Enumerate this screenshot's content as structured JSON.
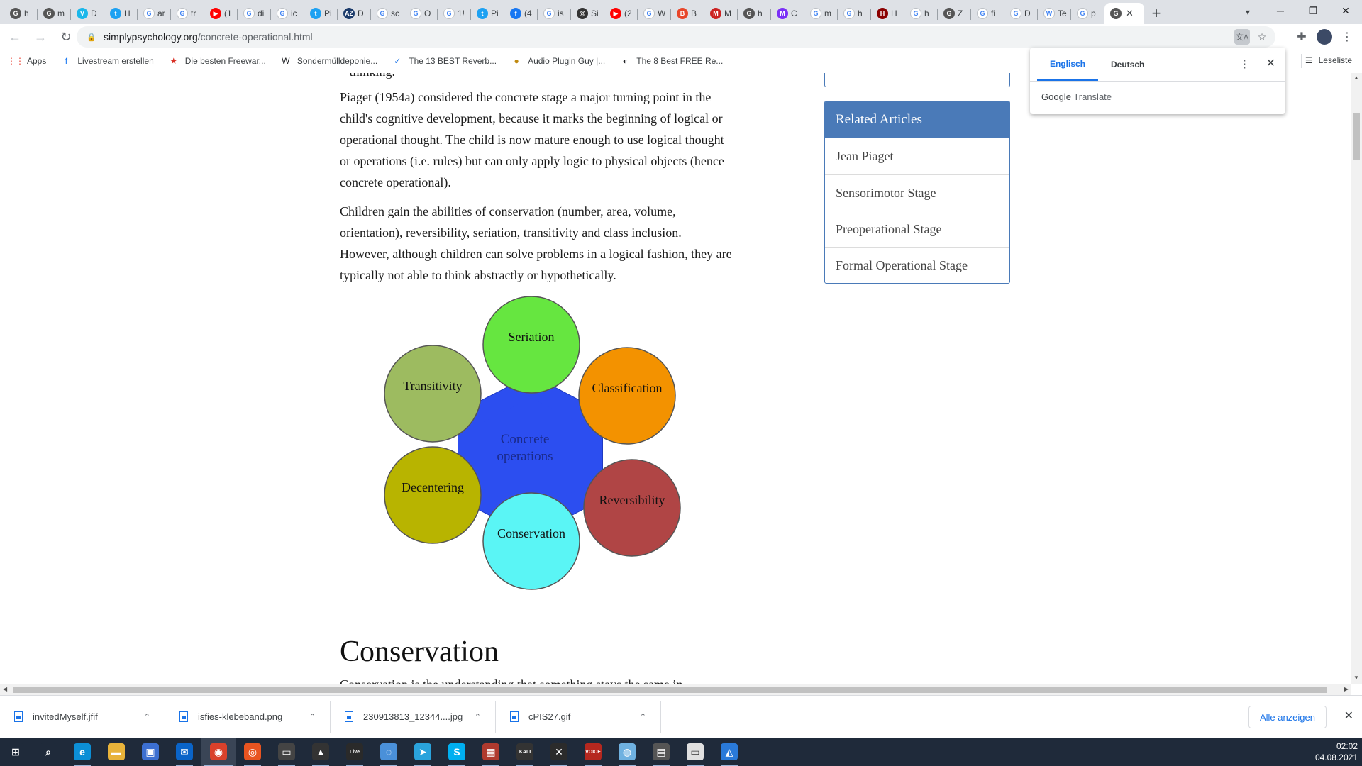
{
  "browser": {
    "tabs": [
      {
        "fav": "G",
        "color": "#555555",
        "text": "h"
      },
      {
        "fav": "G",
        "color": "#555555",
        "text": "m"
      },
      {
        "fav": "V",
        "color": "#1ab7ea",
        "text": "D"
      },
      {
        "fav": "t",
        "color": "#1da1f2",
        "text": "H"
      },
      {
        "fav": "G",
        "color": "#ffffff",
        "text": "ar"
      },
      {
        "fav": "G",
        "color": "#ffffff",
        "text": "tr"
      },
      {
        "fav": "▶",
        "color": "#ff0000",
        "text": "(1"
      },
      {
        "fav": "G",
        "color": "#ffffff",
        "text": "di"
      },
      {
        "fav": "G",
        "color": "#ffffff",
        "text": "ic"
      },
      {
        "fav": "t",
        "color": "#1da1f2",
        "text": "Pi"
      },
      {
        "fav": "AZ",
        "color": "#1a3a6a",
        "text": "D"
      },
      {
        "fav": "G",
        "color": "#ffffff",
        "text": "sc"
      },
      {
        "fav": "G",
        "color": "#ffffff",
        "text": "O"
      },
      {
        "fav": "G",
        "color": "#ffffff",
        "text": "1!"
      },
      {
        "fav": "t",
        "color": "#1da1f2",
        "text": "Pi"
      },
      {
        "fav": "f",
        "color": "#1877f2",
        "text": "(4"
      },
      {
        "fav": "G",
        "color": "#ffffff",
        "text": "is"
      },
      {
        "fav": "@",
        "color": "#333333",
        "text": "Si"
      },
      {
        "fav": "▶",
        "color": "#ff0000",
        "text": "(2"
      },
      {
        "fav": "G",
        "color": "#ffffff",
        "text": "W"
      },
      {
        "fav": "B",
        "color": "#e8462a",
        "text": "B"
      },
      {
        "fav": "M",
        "color": "#cc2222",
        "text": "M"
      },
      {
        "fav": "G",
        "color": "#555555",
        "text": "h"
      },
      {
        "fav": "M",
        "color": "#7b2ff7",
        "text": "C"
      },
      {
        "fav": "G",
        "color": "#ffffff",
        "text": "m"
      },
      {
        "fav": "G",
        "color": "#ffffff",
        "text": "h"
      },
      {
        "fav": "H",
        "color": "#8b0000",
        "text": "H"
      },
      {
        "fav": "G",
        "color": "#ffffff",
        "text": "h"
      },
      {
        "fav": "G",
        "color": "#555555",
        "text": "Z"
      },
      {
        "fav": "G",
        "color": "#ffffff",
        "text": "fi"
      },
      {
        "fav": "G",
        "color": "#ffffff",
        "text": "D"
      },
      {
        "fav": "W",
        "color": "#ffffff",
        "text": "Te"
      },
      {
        "fav": "G",
        "color": "#ffffff",
        "text": "p"
      }
    ],
    "active_tab": {
      "fav": "G",
      "color": "#555555"
    },
    "url_host": "simplypsychology.org",
    "url_path": "/concrete-operational.html",
    "bookmarks": [
      {
        "icon": "⋮⋮",
        "label": "Apps",
        "color": "#ea4335"
      },
      {
        "icon": "f",
        "label": "Livestream erstellen",
        "color": "#1877f2"
      },
      {
        "icon": "★",
        "label": "Die besten Freewar...",
        "color": "#d93025"
      },
      {
        "icon": "W",
        "label": "Sondermülldeponie...",
        "color": "#202124"
      },
      {
        "icon": "✓",
        "label": "The 13 BEST Reverb...",
        "color": "#1a73e8"
      },
      {
        "icon": "●",
        "label": "Audio Plugin Guy |...",
        "color": "#c08a10"
      },
      {
        "icon": "◐",
        "label": "The 8 Best FREE Re...",
        "color": "#202124"
      }
    ],
    "reading_list": "Leseliste"
  },
  "translate": {
    "tab_source": "Englisch",
    "tab_target": "Deutsch",
    "brand_google": "Google",
    "brand_translate": "Translate"
  },
  "article": {
    "top_fragment": "– thinking.",
    "paragraph1": "Piaget (1954a) considered the concrete stage a major turning point in the child's cognitive development, because it marks the beginning of logical or operational thought. The child is now mature enough to use logical thought or operations (i.e. rules) but can only apply logic to physical objects (hence concrete operational).",
    "paragraph2": "Children gain the abilities of conservation (number, area, volume, orientation), reversibility, seriation, transitivity and class inclusion. However, although children can solve problems in a logical fashion, they are typically not able to think abstractly or hypothetically.",
    "heading": "Conservation",
    "next_line": "Conservation is the understanding that something stays the same in"
  },
  "diagram": {
    "center_line1": "Concrete",
    "center_line2": "operations",
    "center_color": "#2c4ef0",
    "nodes": [
      {
        "label": "Seriation",
        "color": "#66e640"
      },
      {
        "label": "Classification",
        "color": "#f39200"
      },
      {
        "label": "Reversibility",
        "color": "#b04545"
      },
      {
        "label": "Conservation",
        "color": "#5af5f5"
      },
      {
        "label": "Decentering",
        "color": "#b8b400"
      },
      {
        "label": "Transitivity",
        "color": "#9dbb60"
      }
    ]
  },
  "sidebar": {
    "heading": "Related Articles",
    "items": [
      "Jean Piaget",
      "Sensorimotor Stage",
      "Preoperational Stage",
      "Formal Operational Stage"
    ]
  },
  "downloads": {
    "items": [
      "invitedMyself.jfif",
      "isfies-klebeband.png",
      "230913813_12344....jpg",
      "cPIS27.gif"
    ],
    "show_all": "Alle anzeigen"
  },
  "taskbar": {
    "apps": [
      {
        "icon": "windows-logo-icon",
        "glyph": "⊞",
        "color": "#1f2a3a"
      },
      {
        "icon": "search-icon",
        "glyph": "⌕",
        "color": "#1f2a3a"
      },
      {
        "icon": "edge-icon",
        "glyph": "e",
        "color": "#0c8fd6"
      },
      {
        "icon": "folder-icon",
        "glyph": "▬",
        "color": "#e8b33a"
      },
      {
        "icon": "store-icon",
        "glyph": "▣",
        "color": "#3c6fd1"
      },
      {
        "icon": "mail-icon",
        "glyph": "✉",
        "color": "#0a64c8"
      },
      {
        "icon": "chrome-icon",
        "glyph": "◉",
        "color": "#d9412b"
      },
      {
        "icon": "ubuntu-icon",
        "glyph": "◎",
        "color": "#e95420"
      },
      {
        "icon": "terminal-icon",
        "glyph": "▭",
        "color": "#444444"
      },
      {
        "icon": "inkscape-icon",
        "glyph": "▲",
        "color": "#333333"
      },
      {
        "icon": "live-icon",
        "glyph": "Live",
        "color": "#2a2a2a"
      },
      {
        "icon": "chat-icon",
        "glyph": "◌",
        "color": "#4a90d9"
      },
      {
        "icon": "telegram-icon",
        "glyph": "➤",
        "color": "#2aa3dc"
      },
      {
        "icon": "skype-icon",
        "glyph": "S",
        "color": "#00aff0"
      },
      {
        "icon": "calculator-icon",
        "glyph": "▦",
        "color": "#b03a2e"
      },
      {
        "icon": "kali-icon",
        "glyph": "KALI",
        "color": "#333333"
      },
      {
        "icon": "x-icon",
        "glyph": "✕",
        "color": "#2b2b2b"
      },
      {
        "icon": "voicemeeter-icon",
        "glyph": "VOICE",
        "color": "#b5281f"
      },
      {
        "icon": "discord-icon",
        "glyph": "◍",
        "color": "#6fb1e0"
      },
      {
        "icon": "app-icon",
        "glyph": "▤",
        "color": "#555555"
      },
      {
        "icon": "window-icon",
        "glyph": "▭",
        "color": "#e0e0e0"
      },
      {
        "icon": "photos-icon",
        "glyph": "◭",
        "color": "#2a7ad9"
      }
    ],
    "time": "02:02",
    "date": "04.08.2021"
  }
}
